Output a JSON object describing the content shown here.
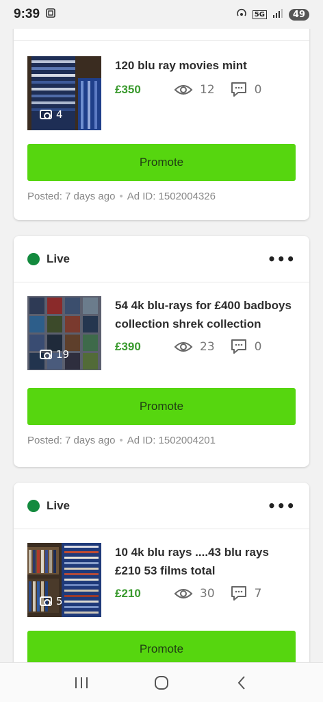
{
  "status_bar": {
    "time": "9:39",
    "network": "5G",
    "battery": "49"
  },
  "listings": [
    {
      "status": "",
      "title": "120 blu ray movies mint",
      "photo_count": "4",
      "price": "£350",
      "views": "12",
      "messages": "0",
      "promote_label": "Promote",
      "posted": "Posted: 7 days ago",
      "ad_id": "Ad ID: 1502004326"
    },
    {
      "status": "Live",
      "title": "54 4k blu-rays for £400 badboys collection shrek collection",
      "photo_count": "19",
      "price": "£390",
      "views": "23",
      "messages": "0",
      "promote_label": "Promote",
      "posted": "Posted: 7 days ago",
      "ad_id": "Ad ID: 1502004201"
    },
    {
      "status": "Live",
      "title": "10 4k blu rays ....43 blu rays £210 53 films total",
      "photo_count": "5",
      "price": "£210",
      "views": "30",
      "messages": "7",
      "promote_label": "Promote"
    }
  ],
  "colors": {
    "live": "#138a3e",
    "promote": "#56d60f",
    "price": "#3a9a2e"
  }
}
